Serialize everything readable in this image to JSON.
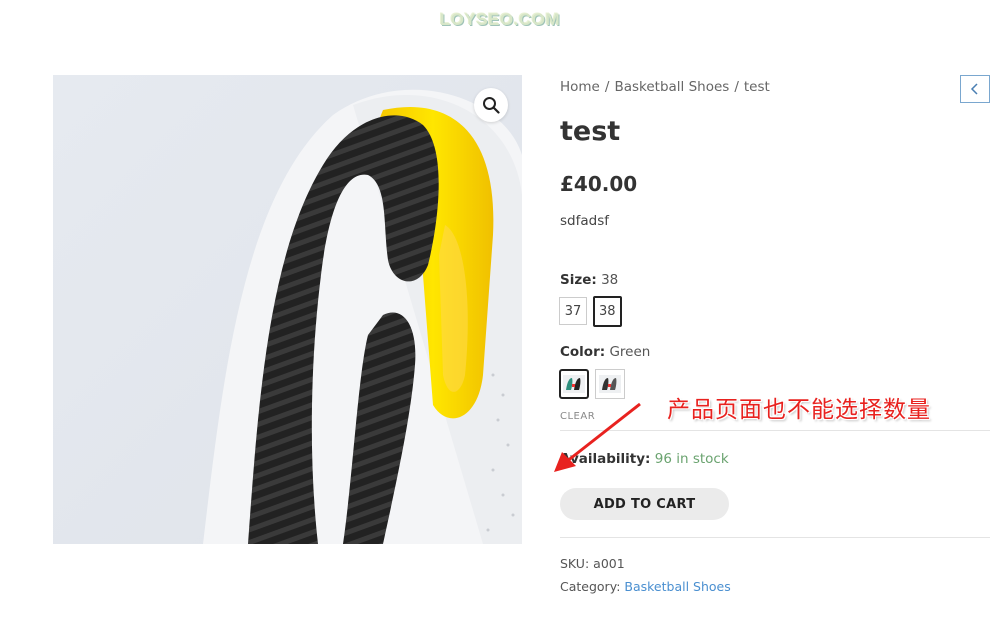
{
  "site": {
    "logo_text": "LOYSEO.COM"
  },
  "gallery": {
    "zoom_icon": "magnifier-icon"
  },
  "breadcrumb": {
    "items": [
      "Home",
      "Basketball Shoes",
      "test"
    ],
    "separator": "/"
  },
  "nav": {
    "prev_icon": "chevron-left-icon"
  },
  "product": {
    "title": "test",
    "price": "£40.00",
    "short_description": "sdfadsf",
    "size": {
      "label": "Size:",
      "selected": "38",
      "options": [
        "37",
        "38"
      ]
    },
    "color": {
      "label": "Color:",
      "selected": "Green",
      "swatch_icons": [
        "shoe-thumbnail-green",
        "shoe-thumbnail-black"
      ]
    },
    "clear_label": "CLEAR",
    "availability": {
      "label": "Availability:",
      "value": "96 in stock"
    },
    "add_to_cart_label": "ADD TO CART",
    "sku": {
      "label": "SKU:",
      "value": "a001"
    },
    "category": {
      "label": "Category:",
      "value": "Basketball Shoes"
    }
  },
  "annotation": {
    "text": "产品页面也不能选择数量",
    "color": "#e8221f"
  },
  "colors": {
    "link": "#4a8fd0",
    "stock": "#6aa36f",
    "button_bg": "#ebebeb"
  }
}
